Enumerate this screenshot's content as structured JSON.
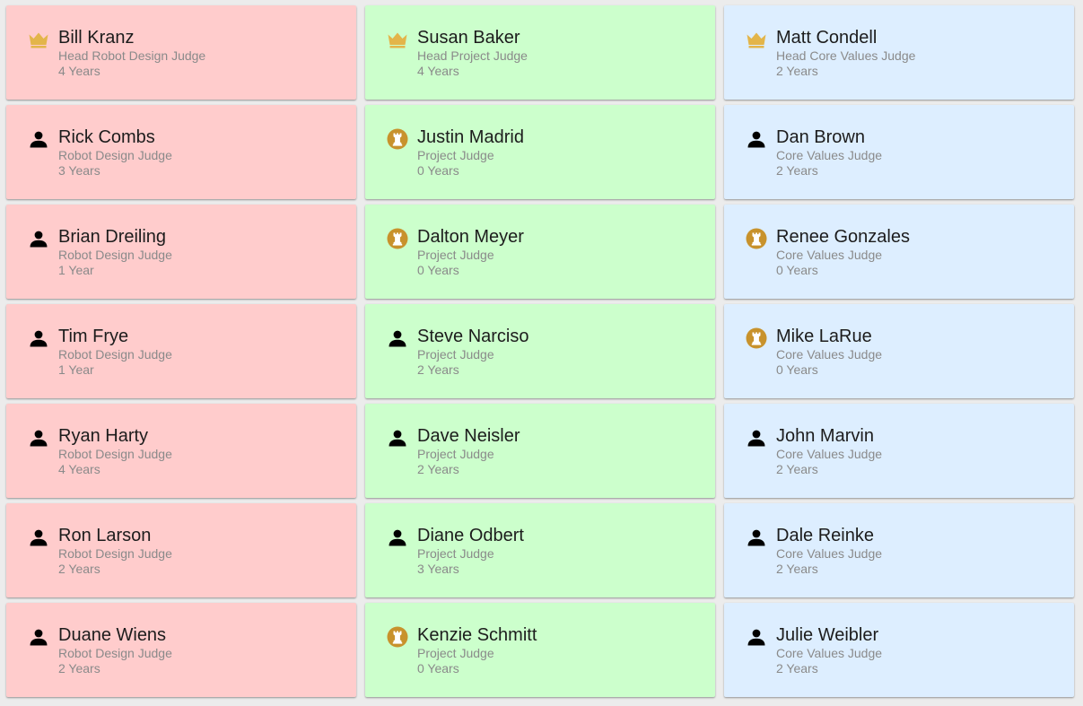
{
  "colors": {
    "robot_design_card": "#ffcccc",
    "project_card": "#ccffcc",
    "core_values_card": "#ddeeff",
    "crown_icon": "#e3b54a",
    "rookie_icon": "#c8922c",
    "person_icon": "#000000"
  },
  "columns": [
    {
      "judges": [
        {
          "name": "Bill Kranz",
          "role": "Head Robot Design Judge",
          "years": "4 Years",
          "icon": "crown-icon"
        },
        {
          "name": "Rick Combs",
          "role": "Robot Design Judge",
          "years": "3 Years",
          "icon": "person-icon"
        },
        {
          "name": "Brian Dreiling",
          "role": "Robot Design Judge",
          "years": "1 Year",
          "icon": "person-icon"
        },
        {
          "name": "Tim Frye",
          "role": "Robot Design Judge",
          "years": "1 Year",
          "icon": "person-icon"
        },
        {
          "name": "Ryan Harty",
          "role": "Robot Design Judge",
          "years": "4 Years",
          "icon": "person-icon"
        },
        {
          "name": "Ron Larson",
          "role": "Robot Design Judge",
          "years": "2 Years",
          "icon": "person-icon"
        },
        {
          "name": "Duane Wiens",
          "role": "Robot Design Judge",
          "years": "2 Years",
          "icon": "person-icon"
        }
      ]
    },
    {
      "judges": [
        {
          "name": "Susan Baker",
          "role": "Head Project Judge",
          "years": "4 Years",
          "icon": "crown-icon"
        },
        {
          "name": "Justin Madrid",
          "role": "Project Judge",
          "years": "0 Years",
          "icon": "rookie-chess-icon"
        },
        {
          "name": "Dalton Meyer",
          "role": "Project Judge",
          "years": "0 Years",
          "icon": "rookie-chess-icon"
        },
        {
          "name": "Steve Narciso",
          "role": "Project Judge",
          "years": "2 Years",
          "icon": "person-icon"
        },
        {
          "name": "Dave Neisler",
          "role": "Project Judge",
          "years": "2 Years",
          "icon": "person-icon"
        },
        {
          "name": "Diane Odbert",
          "role": "Project Judge",
          "years": "3 Years",
          "icon": "person-icon"
        },
        {
          "name": "Kenzie Schmitt",
          "role": "Project Judge",
          "years": "0 Years",
          "icon": "rookie-chess-icon"
        }
      ]
    },
    {
      "judges": [
        {
          "name": "Matt Condell",
          "role": "Head Core Values Judge",
          "years": "2 Years",
          "icon": "crown-icon"
        },
        {
          "name": "Dan Brown",
          "role": "Core Values Judge",
          "years": "2 Years",
          "icon": "person-icon"
        },
        {
          "name": "Renee Gonzales",
          "role": "Core Values Judge",
          "years": "0 Years",
          "icon": "rookie-chess-icon"
        },
        {
          "name": "Mike LaRue",
          "role": "Core Values Judge",
          "years": "0 Years",
          "icon": "rookie-chess-icon"
        },
        {
          "name": "John Marvin",
          "role": "Core Values Judge",
          "years": "2 Years",
          "icon": "person-icon"
        },
        {
          "name": "Dale Reinke",
          "role": "Core Values Judge",
          "years": "2 Years",
          "icon": "person-icon"
        },
        {
          "name": "Julie Weibler",
          "role": "Core Values Judge",
          "years": "2 Years",
          "icon": "person-icon"
        }
      ]
    }
  ]
}
